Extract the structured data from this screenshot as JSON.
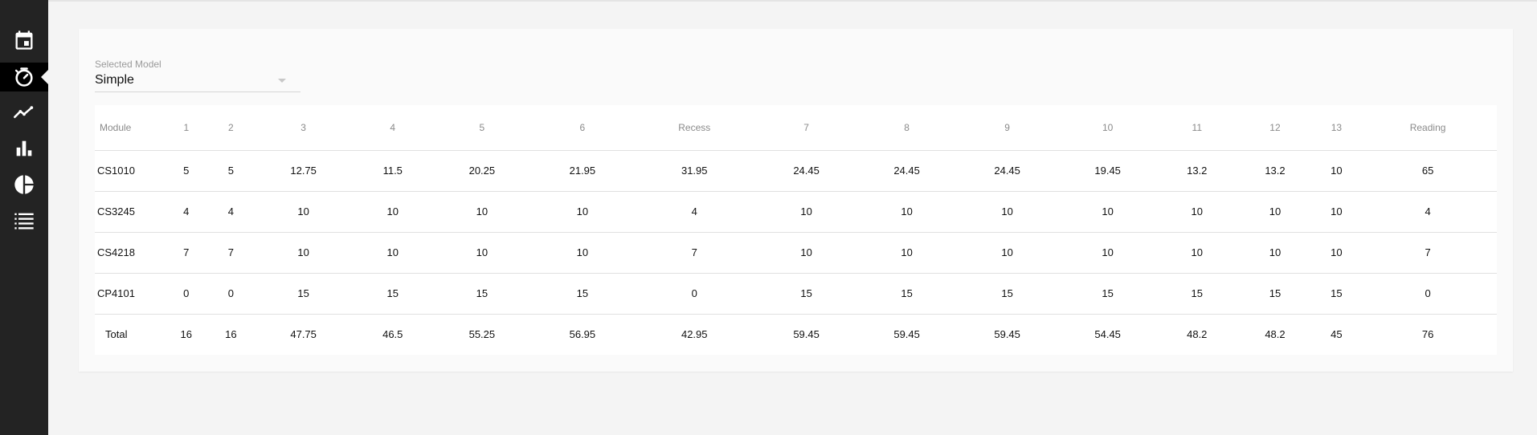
{
  "sidebar": {
    "items": [
      {
        "icon": "calendar-icon"
      },
      {
        "icon": "timer-icon",
        "active": true
      },
      {
        "icon": "line-chart-icon"
      },
      {
        "icon": "bar-chart-icon"
      },
      {
        "icon": "pie-chart-icon"
      },
      {
        "icon": "list-icon"
      }
    ]
  },
  "model_select": {
    "label": "Selected Model",
    "value": "Simple"
  },
  "table": {
    "headers": [
      "Module",
      "1",
      "2",
      "3",
      "4",
      "5",
      "6",
      "Recess",
      "7",
      "8",
      "9",
      "10",
      "11",
      "12",
      "13",
      "Reading"
    ],
    "rows": [
      [
        "CS1010",
        "5",
        "5",
        "12.75",
        "11.5",
        "20.25",
        "21.95",
        "31.95",
        "24.45",
        "24.45",
        "24.45",
        "19.45",
        "13.2",
        "13.2",
        "10",
        "65"
      ],
      [
        "CS3245",
        "4",
        "4",
        "10",
        "10",
        "10",
        "10",
        "4",
        "10",
        "10",
        "10",
        "10",
        "10",
        "10",
        "10",
        "4"
      ],
      [
        "CS4218",
        "7",
        "7",
        "10",
        "10",
        "10",
        "10",
        "7",
        "10",
        "10",
        "10",
        "10",
        "10",
        "10",
        "10",
        "7"
      ],
      [
        "CP4101",
        "0",
        "0",
        "15",
        "15",
        "15",
        "15",
        "0",
        "15",
        "15",
        "15",
        "15",
        "15",
        "15",
        "15",
        "0"
      ],
      [
        "Total",
        "16",
        "16",
        "47.75",
        "46.5",
        "55.25",
        "56.95",
        "42.95",
        "59.45",
        "59.45",
        "59.45",
        "54.45",
        "48.2",
        "48.2",
        "45",
        "76"
      ]
    ]
  },
  "colors": {
    "sidebar": "#232323",
    "sidebar_active": "#000000",
    "background": "#f4f4f4"
  }
}
